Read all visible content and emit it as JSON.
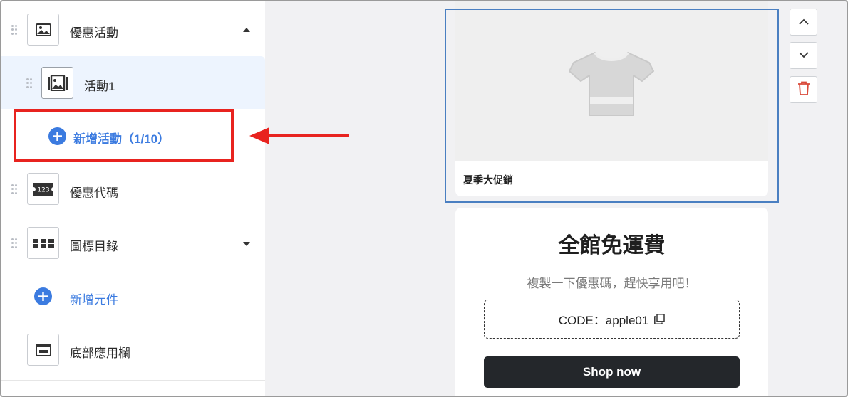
{
  "sidebar": {
    "items": [
      {
        "label": "優惠活動",
        "icon": "image-icon",
        "expanded": true
      },
      {
        "label": "活動1",
        "icon": "gallery-icon",
        "selected": true
      },
      {
        "label": "新增活動（1/10）",
        "icon": "plus-circle-icon"
      },
      {
        "label": "優惠代碼",
        "icon": "coupon-icon"
      },
      {
        "label": "圖標目錄",
        "icon": "grid-icon",
        "expanded": false
      },
      {
        "label": "新增元件",
        "icon": "plus-circle-icon"
      },
      {
        "label": "底部應用欄",
        "icon": "bottom-bar-icon"
      }
    ]
  },
  "preview": {
    "campaign_card": {
      "title": "夏季大促銷",
      "image_icon": "tshirt-icon"
    },
    "coupon_card": {
      "title": "全館免運費",
      "subtitle": "複製一下優惠碼，趕快享用吧！",
      "code": "CODE：apple01",
      "button": "Shop now"
    }
  },
  "controls": {
    "icons": [
      "chevron-up-icon",
      "chevron-down-icon",
      "trash-icon"
    ]
  },
  "colors": {
    "accent": "#3b7be0",
    "highlight": "#e8231f",
    "selected_bg": "#edf4fe",
    "button_dark": "#24272b"
  }
}
